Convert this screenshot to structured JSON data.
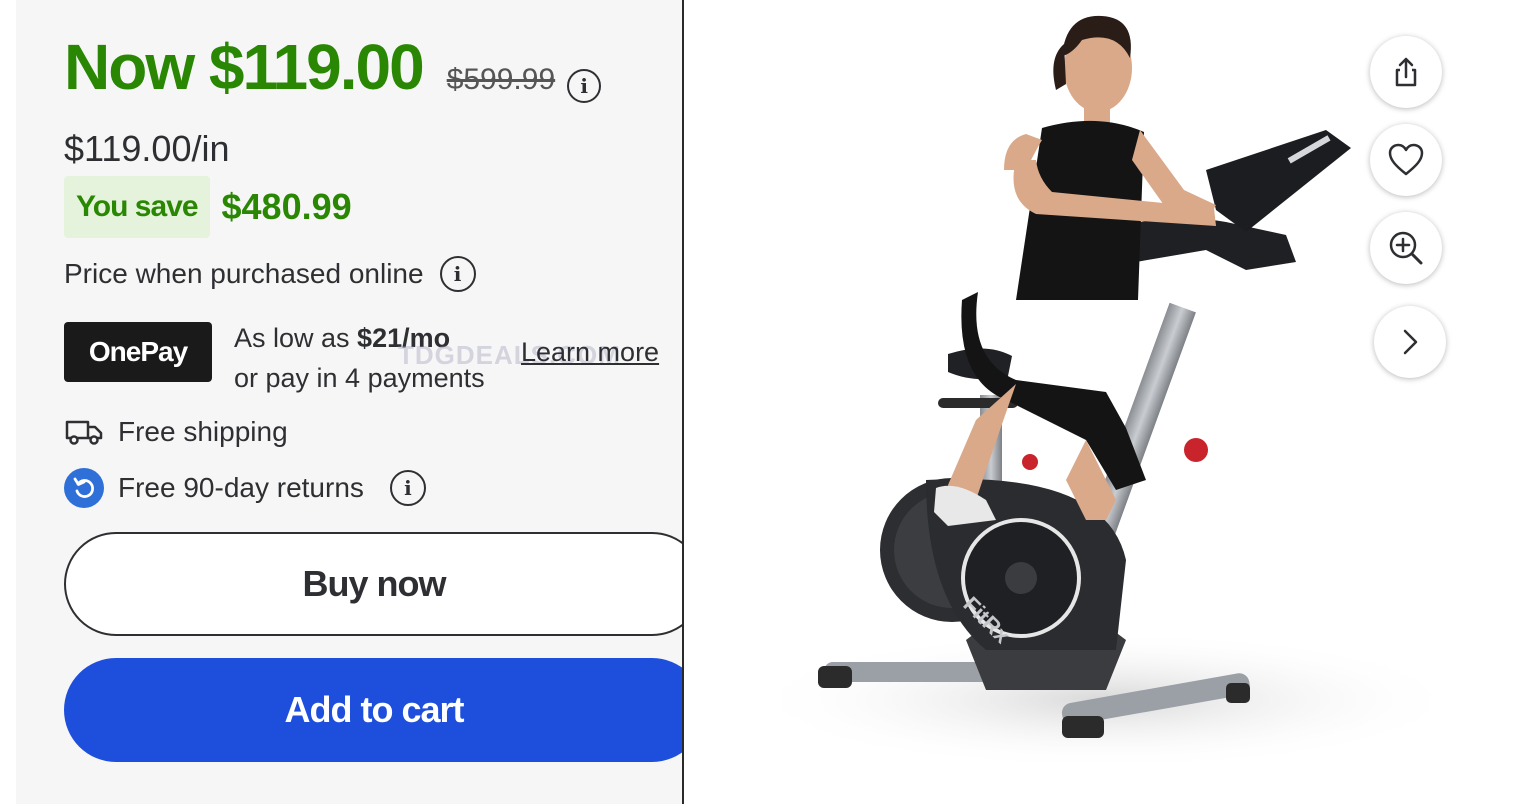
{
  "pricing": {
    "now_price": "Now $119.00",
    "was_price": "$599.99",
    "unit_price": "$119.00/in",
    "you_save_label": "You save",
    "save_amount": "$480.99",
    "purchase_note": "Price when purchased online"
  },
  "onepay": {
    "badge": "OnePay",
    "as_low_as": "As low as ",
    "monthly": "$21/mo",
    "pay_in_4": "or pay in 4 payments",
    "learn_more": "Learn more"
  },
  "watermark": "TDGDEALS.COM",
  "features": {
    "shipping": "Free shipping",
    "returns": "Free 90-day returns"
  },
  "buttons": {
    "buy_now": "Buy now",
    "add_to_cart": "Add to cart"
  },
  "product_image": {
    "brand_text": "FitRx"
  },
  "colors": {
    "price_green": "#2a8703",
    "save_bg": "#e5f3dc",
    "cart_blue": "#1e4fdc",
    "onepay_bg": "#1a1a1a"
  },
  "icons": [
    "info-icon",
    "truck-icon",
    "return-icon",
    "share-icon",
    "heart-icon",
    "zoom-in-icon",
    "chevron-right-icon"
  ]
}
